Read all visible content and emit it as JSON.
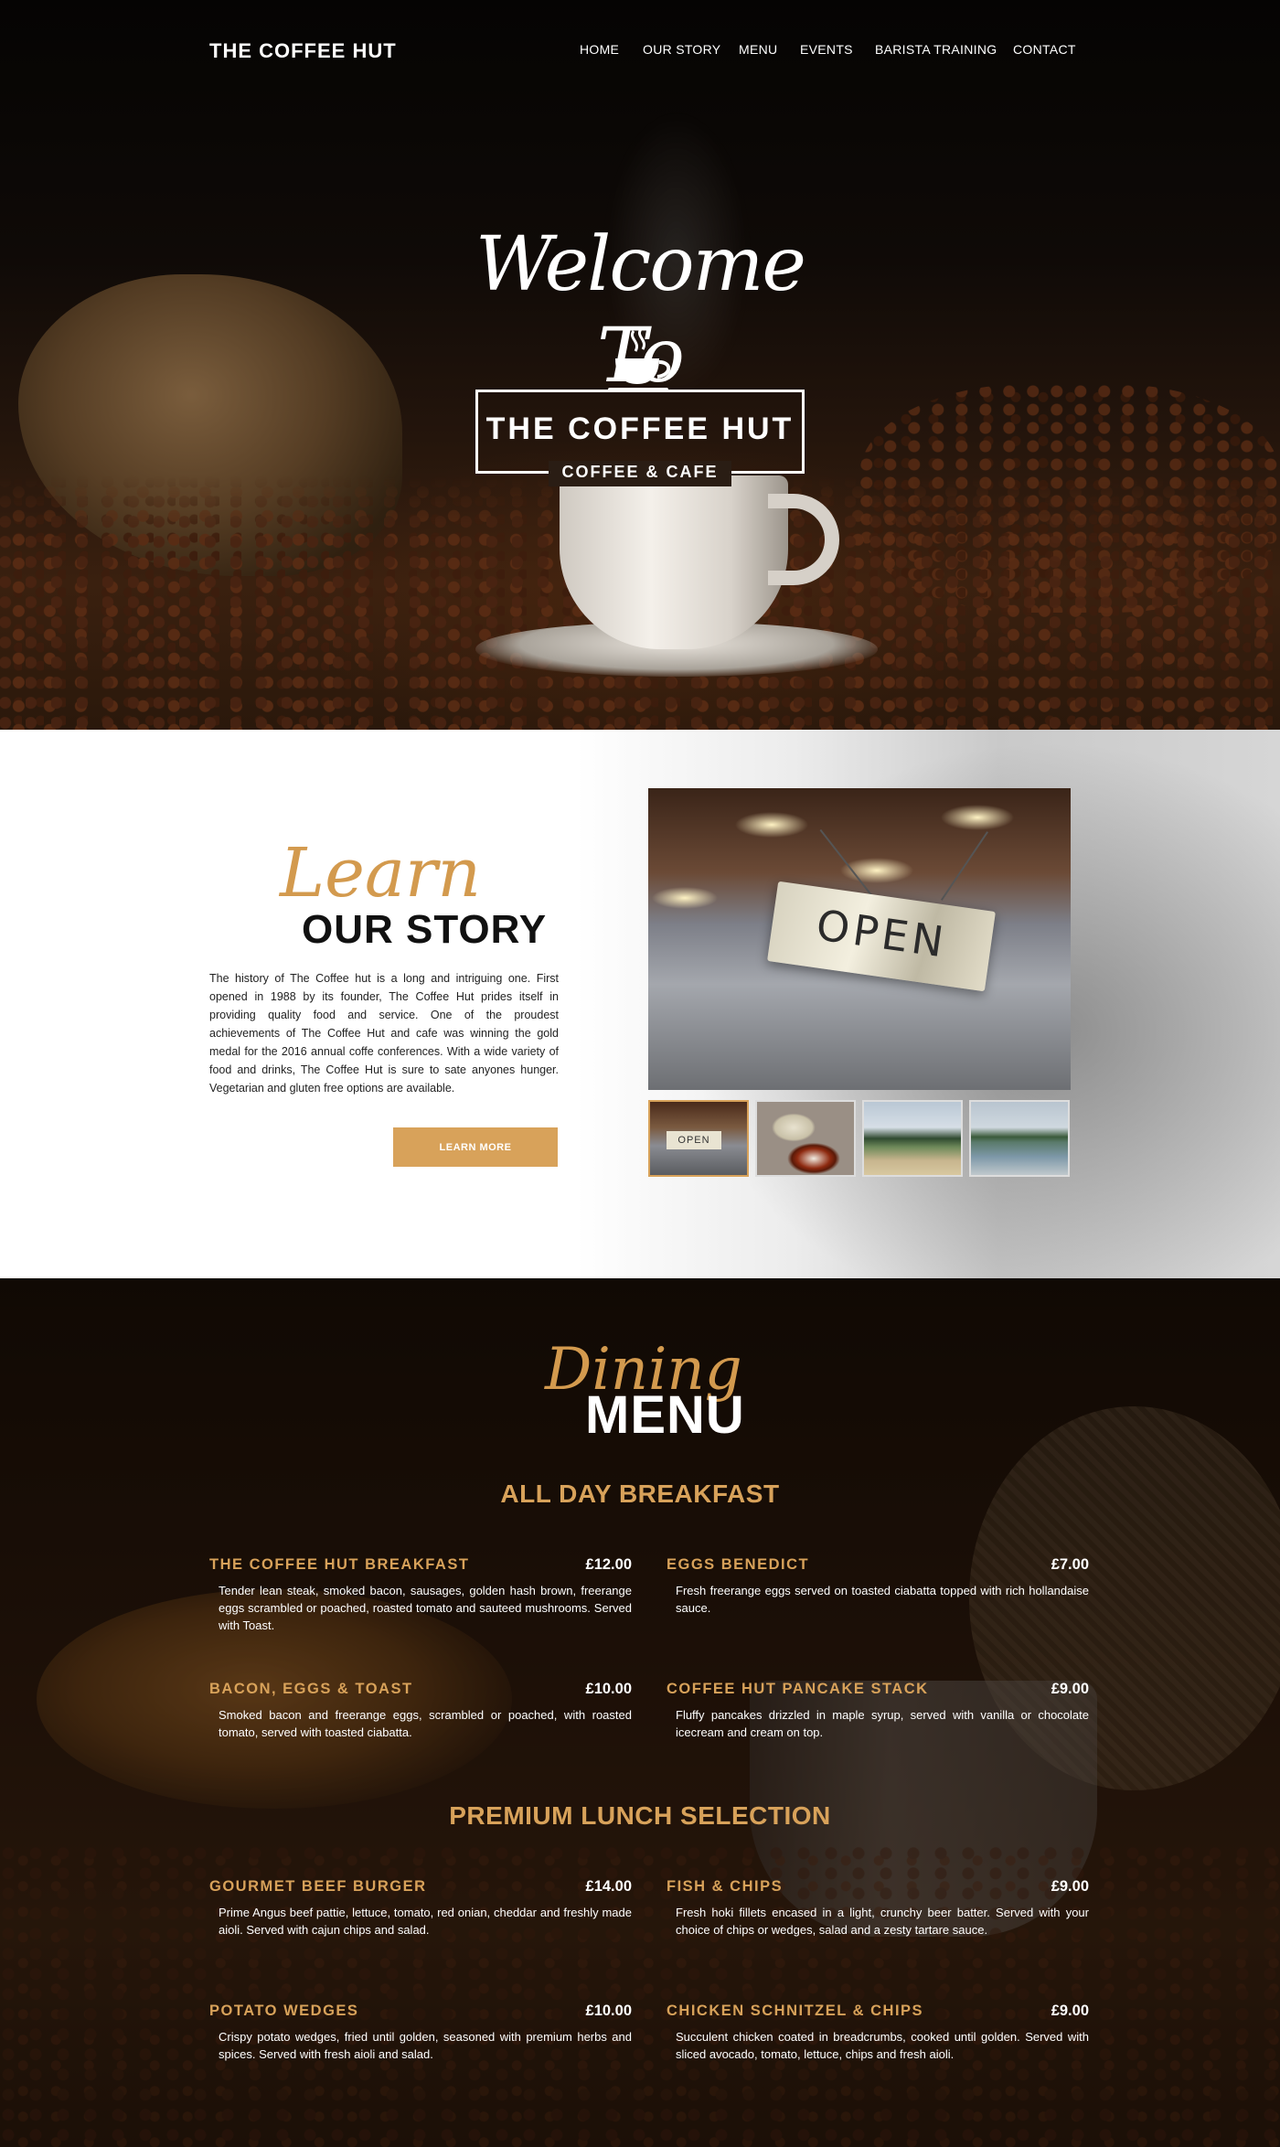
{
  "nav": {
    "brand": "THE COFFEE HUT",
    "links": [
      "HOME",
      "OUR STORY",
      "MENU",
      "EVENTS",
      "BARISTA TRAINING",
      "CONTACT"
    ]
  },
  "hero": {
    "welcome": "Welcome To",
    "logo_title": "THE COFFEE HUT",
    "logo_subtitle": "COFFEE & CAFE"
  },
  "story": {
    "script": "Learn",
    "heading": "OUR STORY",
    "body": "The history of The Coffee hut is a long and intriguing one. First opened in 1988 by its founder, The Coffee Hut prides itself in providing quality food and service. One of the proudest achievements of The Coffee Hut and cafe was winning the gold medal for the 2016 annual coffe conferences. With a wide variety of food and drinks, The Coffee Hut is sure to sate anyones hunger.  Vegetarian and gluten free options are available.",
    "button": "LEARN MORE",
    "photo_sign": "OPEN"
  },
  "menu": {
    "script": "Dining",
    "heading": "MENU",
    "sections": [
      {
        "title": "ALL DAY BREAKFAST",
        "items": [
          {
            "name": "THE COFFEE HUT BREAKFAST",
            "price": "£12.00",
            "desc": "Tender lean steak, smoked bacon, sausages, golden hash brown, freerange eggs scrambled or poached, roasted tomato and sauteed mushrooms. Served with Toast."
          },
          {
            "name": "EGGS BENEDICT",
            "price": "£7.00",
            "desc": "Fresh freerange eggs served on toasted ciabatta topped with rich hollandaise sauce."
          },
          {
            "name": "BACON, EGGS & TOAST",
            "price": "£10.00",
            "desc": "Smoked bacon and freerange eggs, scrambled or poached, with roasted tomato, served with toasted ciabatta."
          },
          {
            "name": "COFFEE HUT PANCAKE STACK",
            "price": "£9.00",
            "desc": "Fluffy pancakes drizzled in maple syrup, served with vanilla or chocolate icecream and cream on top."
          }
        ]
      },
      {
        "title": "PREMIUM LUNCH SELECTION",
        "items": [
          {
            "name": "GOURMET BEEF BURGER",
            "price": "£14.00",
            "desc": "Prime Angus beef pattie, lettuce, tomato, red onian, cheddar and freshly made aioli.  Served with cajun chips and salad."
          },
          {
            "name": "FISH & CHIPS",
            "price": "£9.00",
            "desc": "Fresh hoki fillets encased in a light, crunchy beer batter. Served with your choice of chips or wedges, salad and a zesty tartare sauce."
          },
          {
            "name": "POTATO WEDGES",
            "price": "£10.00",
            "desc": "Crispy potato wedges, fried until golden, seasoned with premium herbs and spices.  Served with fresh aioli and salad."
          },
          {
            "name": "CHICKEN SCHNITZEL & CHIPS",
            "price": "£9.00",
            "desc": "Succulent chicken coated in breadcrumbs, cooked until golden.  Served with sliced avocado, tomato, lettuce, chips and fresh aioli."
          }
        ]
      }
    ]
  },
  "colors": {
    "accent": "#d8a25a",
    "dark_bg": "#1a0f07"
  }
}
